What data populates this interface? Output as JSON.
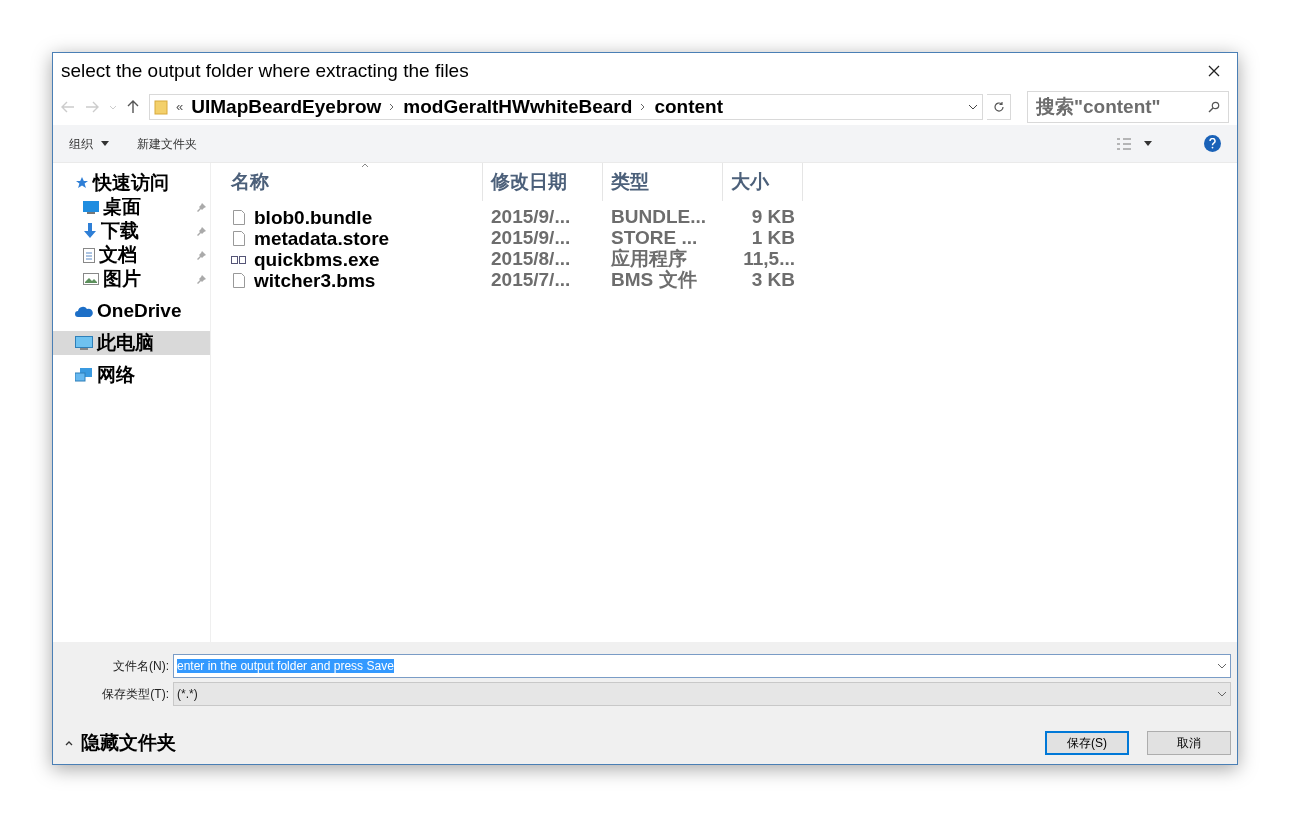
{
  "window": {
    "title": "select the output folder where extracting the files"
  },
  "address_bar": {
    "overflow": "«",
    "path": [
      "UIMapBeardEyebrow",
      "modGeraltHWwhiteBeard",
      "content"
    ]
  },
  "search": {
    "placeholder": "搜索\"content\""
  },
  "toolbar": {
    "organize": "组织",
    "new_folder": "新建文件夹"
  },
  "sidebar": {
    "items": [
      {
        "label": "快速访问",
        "kind": "quick",
        "selected": false,
        "pinned": false,
        "children": [
          {
            "label": "桌面",
            "kind": "desktop",
            "selected": false,
            "pinned": true
          },
          {
            "label": "下载",
            "kind": "download",
            "selected": false,
            "pinned": true
          },
          {
            "label": "文档",
            "kind": "document",
            "selected": false,
            "pinned": true
          },
          {
            "label": "图片",
            "kind": "picture",
            "selected": false,
            "pinned": true
          }
        ]
      },
      {
        "label": "OneDrive",
        "kind": "cloud",
        "selected": false,
        "pinned": false
      },
      {
        "label": "此电脑",
        "kind": "pc",
        "selected": true,
        "pinned": false
      },
      {
        "label": "网络",
        "kind": "network",
        "selected": false,
        "pinned": false
      }
    ]
  },
  "table": {
    "columns": [
      "名称",
      "修改日期",
      "类型",
      "大小"
    ],
    "rows": [
      {
        "kind": "file",
        "name": "blob0.bundle",
        "date": "2015/9/...",
        "type": "BUNDLE...",
        "size": "9 KB"
      },
      {
        "kind": "file",
        "name": "metadata.store",
        "date": "2015/9/...",
        "type": "STORE ...",
        "size": "1 KB"
      },
      {
        "kind": "exe",
        "name": "quickbms.exe",
        "date": "2015/8/...",
        "type": "应用程序",
        "size": "11,5..."
      },
      {
        "kind": "file",
        "name": "witcher3.bms",
        "date": "2015/7/...",
        "type": "BMS 文件",
        "size": "3 KB"
      }
    ]
  },
  "filename": {
    "label": "文件名(N):",
    "value": "enter in the output folder and press Save"
  },
  "filetype": {
    "label": "保存类型(T):",
    "value": "(*.*)"
  },
  "hide_folders": "隐藏文件夹",
  "buttons": [
    "保存(S)",
    "取消"
  ]
}
